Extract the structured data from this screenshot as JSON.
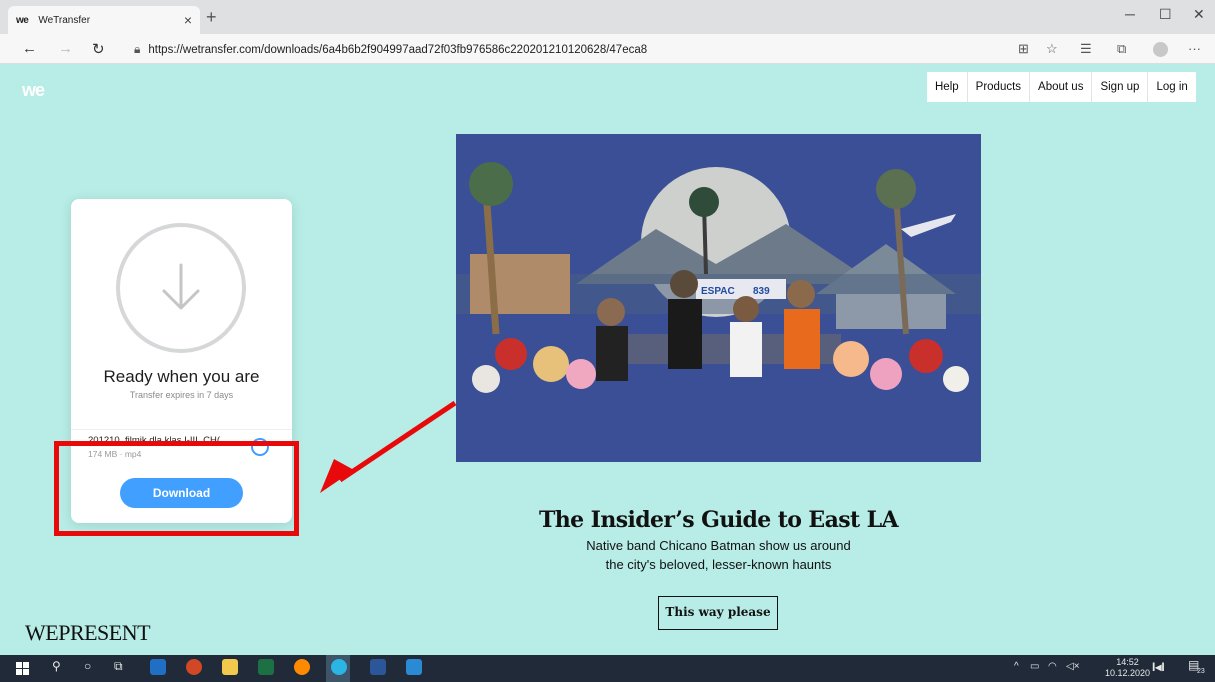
{
  "browser": {
    "tab_favicon": "we",
    "tab_title": "WeTransfer",
    "tab_close": "×",
    "new_tab": "+",
    "url": "https://wetransfer.com/downloads/6a4b6b2f904997aad72f03fb976586c220201210120628/47eca8",
    "window_controls": {
      "minimize": "─",
      "maximize": "☐",
      "close": "✕"
    }
  },
  "site": {
    "logo": "we",
    "nav": [
      "Help",
      "Products",
      "About us",
      "Sign up",
      "Log in"
    ]
  },
  "card": {
    "heading": "Ready when you are",
    "expires": "Transfer expires in 7 days",
    "file_name": "201210_filmik dla klas I-III_CH(",
    "file_meta": "174 MB · mp4",
    "download_label": "Download"
  },
  "promo": {
    "headline": "The Insider’s Guide to East LA",
    "sub_line1": "Native band Chicano Batman show us around",
    "sub_line2": "the city's beloved, lesser-known haunts",
    "cta": "This way please",
    "brand": "WEPRESENT",
    "sign_text": "ESPAC",
    "sign_num": "839"
  },
  "taskbar": {
    "time": "14:52",
    "date": "10.12.2020",
    "notif_count": "23"
  },
  "colors": {
    "page_bg": "#b7ede6",
    "accent": "#409fff",
    "highlight": "#e80a0a",
    "taskbar": "#202a38"
  }
}
